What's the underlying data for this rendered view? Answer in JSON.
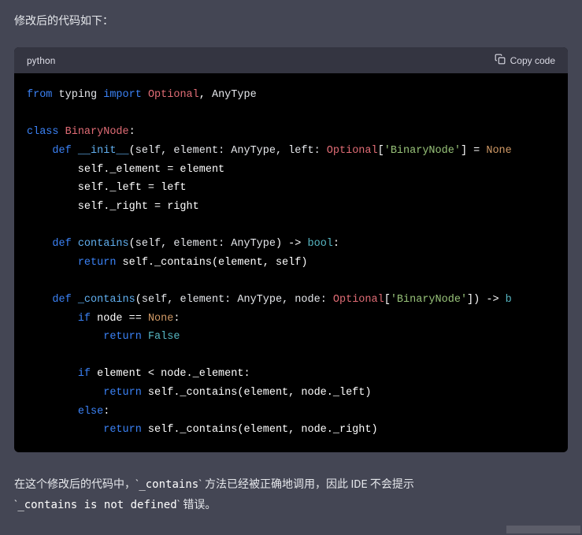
{
  "intro": "修改后的代码如下：",
  "codeblock": {
    "language": "python",
    "copy_label": "Copy code",
    "tokens": [
      [
        [
          "kw",
          "from"
        ],
        [
          "op",
          " "
        ],
        [
          "param",
          "typing"
        ],
        [
          "op",
          " "
        ],
        [
          "kw",
          "import"
        ],
        [
          "op",
          " "
        ],
        [
          "cls",
          "Optional"
        ],
        [
          "op",
          ", "
        ],
        [
          "param",
          "AnyType"
        ]
      ],
      [],
      [
        [
          "kw",
          "class"
        ],
        [
          "op",
          " "
        ],
        [
          "cls",
          "BinaryNode"
        ],
        [
          "op",
          ":"
        ]
      ],
      [
        [
          "op",
          "    "
        ],
        [
          "kw",
          "def"
        ],
        [
          "op",
          " "
        ],
        [
          "fn",
          "__init__"
        ],
        [
          "op",
          "("
        ],
        [
          "param",
          "self, element: AnyType, left: "
        ],
        [
          "cls",
          "Optional"
        ],
        [
          "op",
          "["
        ],
        [
          "str",
          "'BinaryNode'"
        ],
        [
          "op",
          "] = "
        ],
        [
          "none",
          "None"
        ]
      ],
      [
        [
          "op",
          "        self._element = element"
        ]
      ],
      [
        [
          "op",
          "        self._left = left"
        ]
      ],
      [
        [
          "op",
          "        self._right = right"
        ]
      ],
      [],
      [
        [
          "op",
          "    "
        ],
        [
          "kw",
          "def"
        ],
        [
          "op",
          " "
        ],
        [
          "fn",
          "contains"
        ],
        [
          "op",
          "("
        ],
        [
          "param",
          "self, element: AnyType"
        ],
        [
          "op",
          ") -> "
        ],
        [
          "type",
          "bool"
        ],
        [
          "op",
          ":"
        ]
      ],
      [
        [
          "op",
          "        "
        ],
        [
          "kw",
          "return"
        ],
        [
          "op",
          " self._contains(element, self)"
        ]
      ],
      [],
      [
        [
          "op",
          "    "
        ],
        [
          "kw",
          "def"
        ],
        [
          "op",
          " "
        ],
        [
          "fn",
          "_contains"
        ],
        [
          "op",
          "("
        ],
        [
          "param",
          "self, element: AnyType, node: "
        ],
        [
          "cls",
          "Optional"
        ],
        [
          "op",
          "["
        ],
        [
          "str",
          "'BinaryNode'"
        ],
        [
          "op",
          "]) -> "
        ],
        [
          "type",
          "b"
        ]
      ],
      [
        [
          "op",
          "        "
        ],
        [
          "kw",
          "if"
        ],
        [
          "op",
          " node == "
        ],
        [
          "none",
          "None"
        ],
        [
          "op",
          ":"
        ]
      ],
      [
        [
          "op",
          "            "
        ],
        [
          "kw",
          "return"
        ],
        [
          "op",
          " "
        ],
        [
          "lit",
          "False"
        ]
      ],
      [],
      [
        [
          "op",
          "        "
        ],
        [
          "kw",
          "if"
        ],
        [
          "op",
          " element < node._element:"
        ]
      ],
      [
        [
          "op",
          "            "
        ],
        [
          "kw",
          "return"
        ],
        [
          "op",
          " self._contains(element, node._left)"
        ]
      ],
      [
        [
          "op",
          "        "
        ],
        [
          "kw",
          "else"
        ],
        [
          "op",
          ":"
        ]
      ],
      [
        [
          "op",
          "            "
        ],
        [
          "kw",
          "return"
        ],
        [
          "op",
          " self._contains(element, node._right)"
        ]
      ]
    ]
  },
  "outro": {
    "part1": "在这个修改后的代码中，",
    "code1": "_contains",
    "part2": " 方法已经被正确地调用，因此 IDE 不会提示 ",
    "code2": "_contains is not defined",
    "part3": " 错误。"
  }
}
